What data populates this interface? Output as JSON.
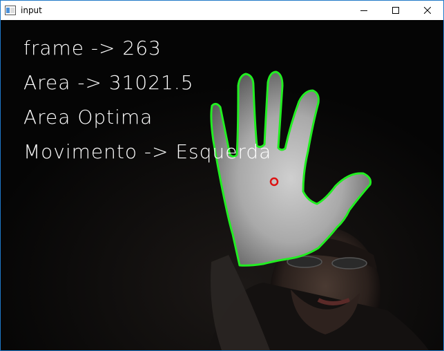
{
  "window": {
    "title": "input"
  },
  "controls": {
    "minimize_icon": "minimize-icon",
    "maximize_icon": "maximize-icon",
    "close_icon": "close-icon"
  },
  "overlay": {
    "frame_line": "frame -> 263",
    "area_line": "Area -> 31021.5",
    "status_line": "Area Optima",
    "movement_line": "Movimento -> Esquerda"
  },
  "colors": {
    "contour": "#22ee22",
    "centroid": "#dd1111",
    "text": "#ffffff",
    "background": "#050505"
  }
}
